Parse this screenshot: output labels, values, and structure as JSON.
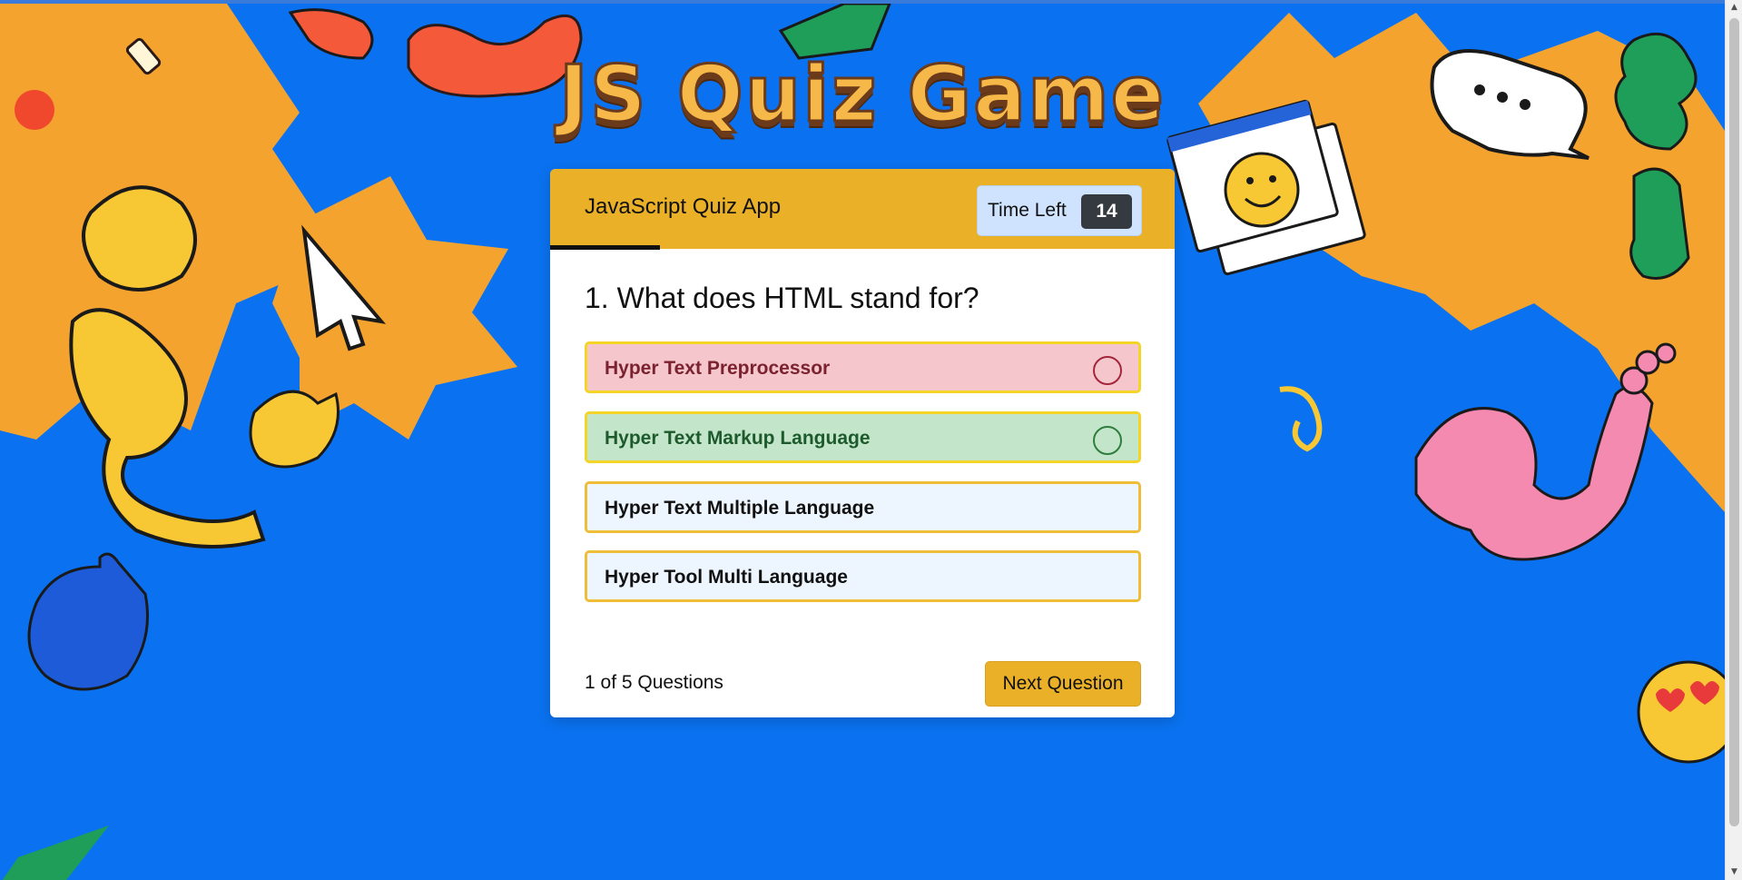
{
  "page": {
    "title": "JS Quiz Game"
  },
  "quiz": {
    "app_title": "JavaScript Quiz App",
    "timer_label": "Time Left",
    "timer_value": "14",
    "question": "1. What does HTML stand for?",
    "options": [
      {
        "label": "Hyper Text Preprocessor",
        "state": "wrong"
      },
      {
        "label": "Hyper Text Markup Language",
        "state": "correct"
      },
      {
        "label": "Hyper Text Multiple Language",
        "state": "default"
      },
      {
        "label": "Hyper Tool Multi Language",
        "state": "default"
      }
    ],
    "progress_text": "1 of 5 Questions",
    "next_label": "Next Question",
    "progress_fraction": 0.2
  },
  "colors": {
    "background": "#0a72f0",
    "header": "#e9b028",
    "wrong_bg": "#f5c6cb",
    "correct_bg": "#c3e6cb",
    "option_bg": "#edf5ff"
  },
  "icons": [
    "radio-circle-icon",
    "smiley-icon",
    "chat-bubble-icon",
    "thumbs-up-icon",
    "cursor-arrow-icon",
    "heart-eyes-emoji-icon"
  ]
}
